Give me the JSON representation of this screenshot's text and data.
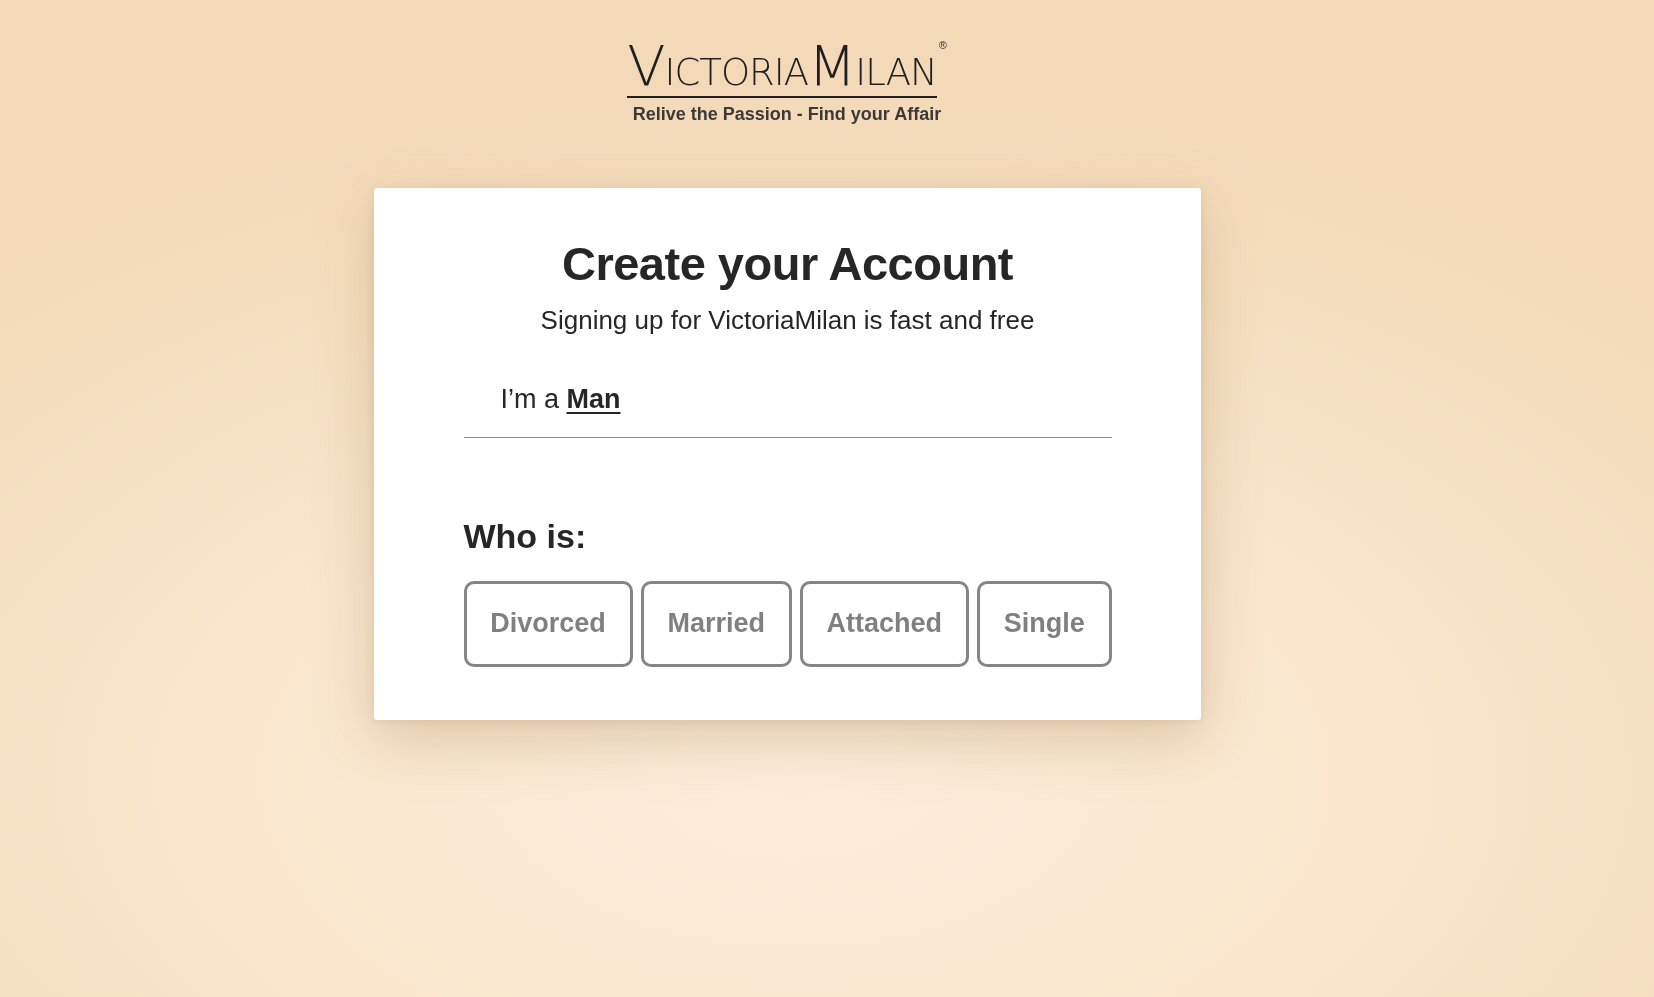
{
  "logo": {
    "wordmark": [
      "VICTORIA",
      "MILAN"
    ],
    "registered_mark": "®",
    "tagline": "Relive the Passion - Find your Affair"
  },
  "card": {
    "title": "Create your Account",
    "subtitle": "Signing up for VictoriaMilan is fast and free",
    "gender_field": {
      "prefix": "I’m a",
      "value": "Man"
    },
    "status_heading": "Who is:",
    "status_options": [
      {
        "label": "Divorced",
        "selected": false
      },
      {
        "label": "Married",
        "selected": false
      },
      {
        "label": "Attached",
        "selected": false
      },
      {
        "label": "Single",
        "selected": false
      }
    ]
  }
}
